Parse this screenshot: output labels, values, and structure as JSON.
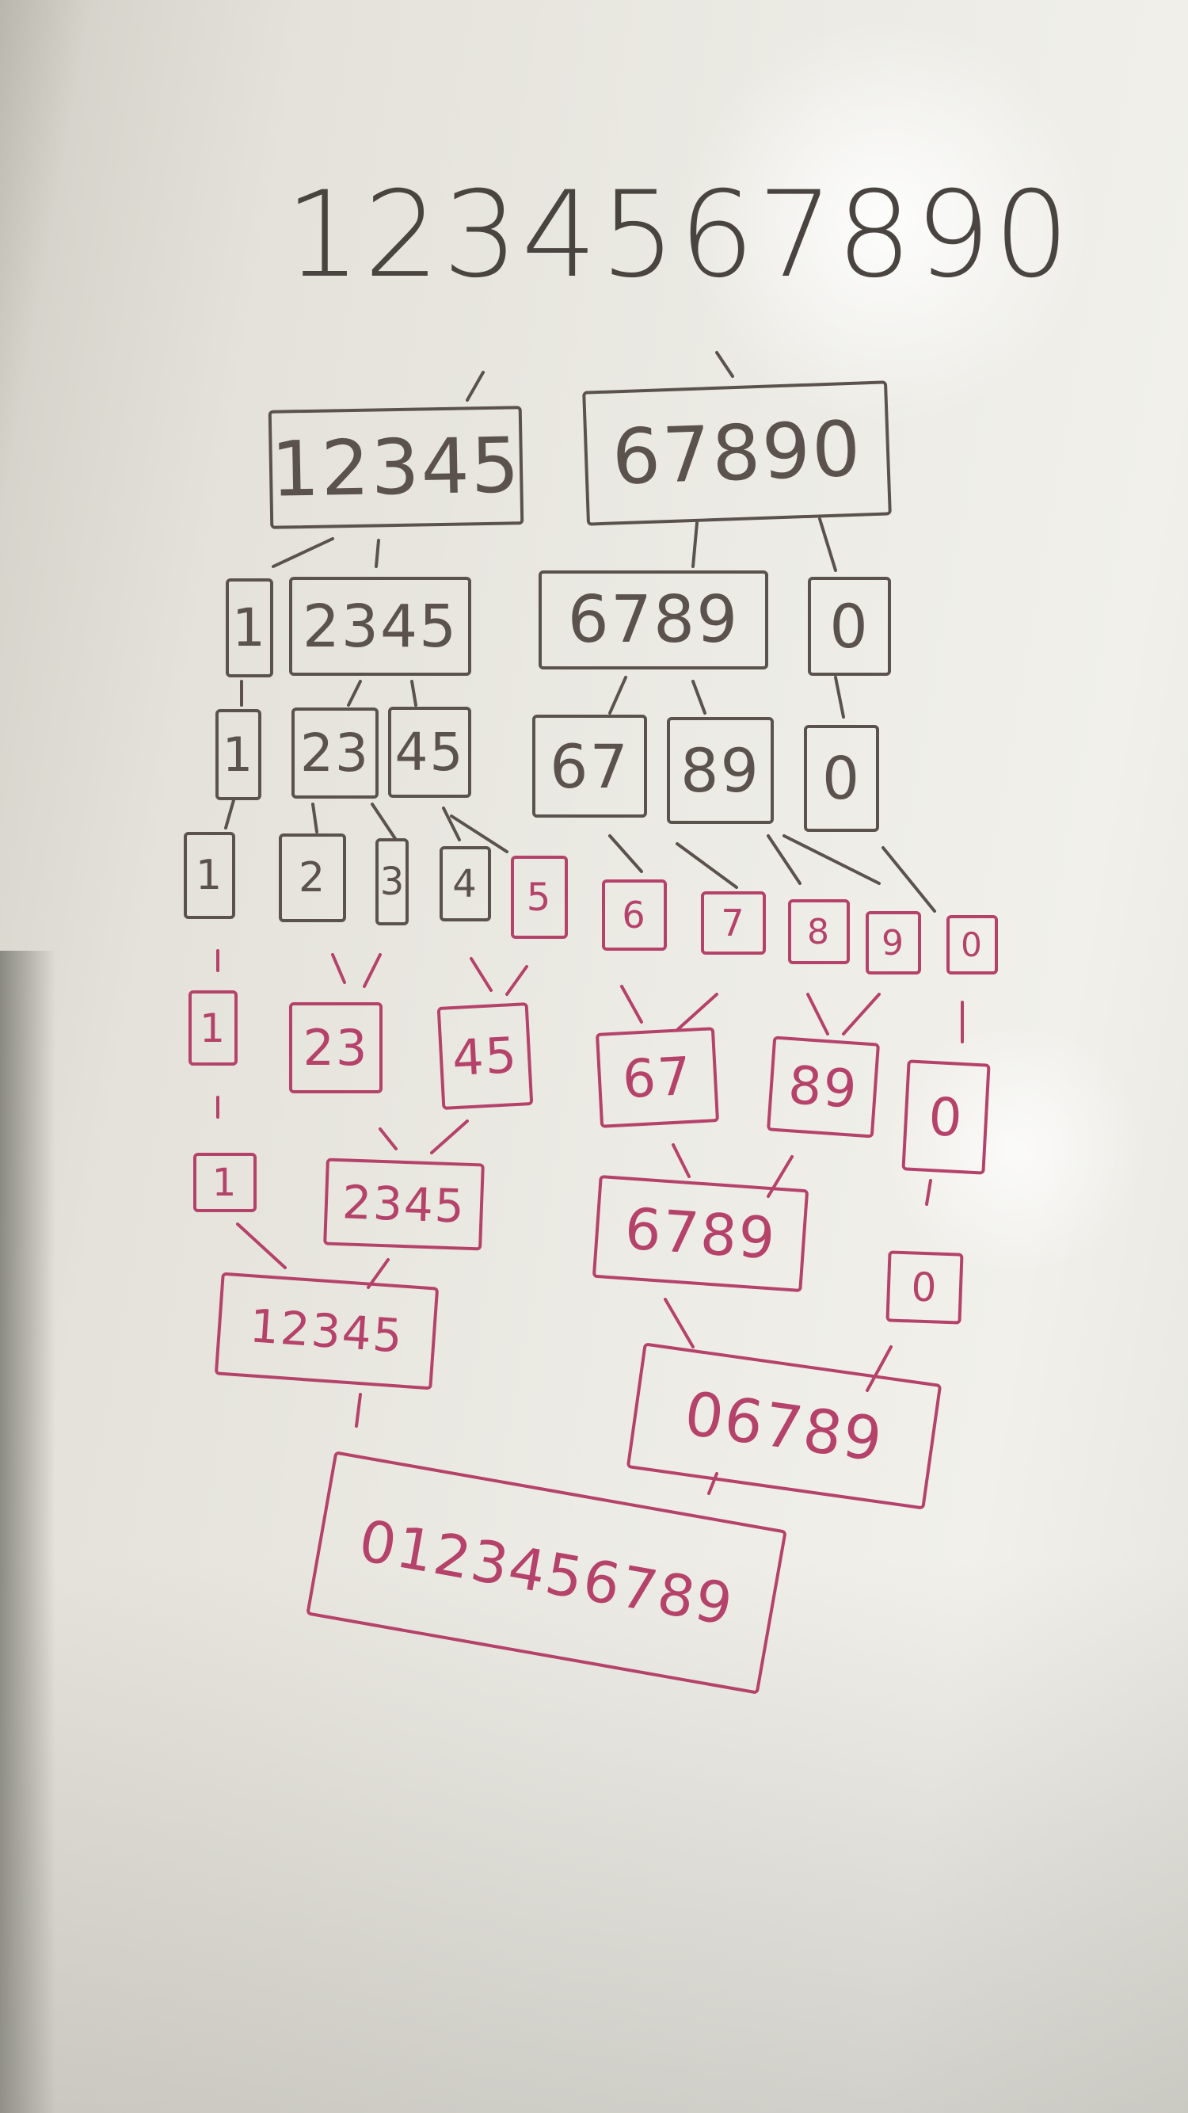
{
  "colors": {
    "split_marker": "#5b524d",
    "merge_marker": "#b5426a",
    "board": "#ecebe5"
  },
  "top_sequence": "1234567890",
  "split": {
    "level1": [
      "12345",
      "67890"
    ],
    "level2": [
      "1",
      "2345",
      "6789",
      "0"
    ],
    "level3": [
      "1",
      "23",
      "45",
      "67",
      "89",
      "0"
    ]
  },
  "singles": [
    "1",
    "2",
    "3",
    "4",
    "5",
    "6",
    "7",
    "8",
    "9",
    "0"
  ],
  "merge": {
    "level1": [
      "1",
      "23",
      "45",
      "67",
      "89",
      "0"
    ],
    "level2": [
      "1",
      "2345",
      "6789",
      "0"
    ],
    "level3": [
      "12345",
      "06789"
    ],
    "final": "0123456789"
  }
}
